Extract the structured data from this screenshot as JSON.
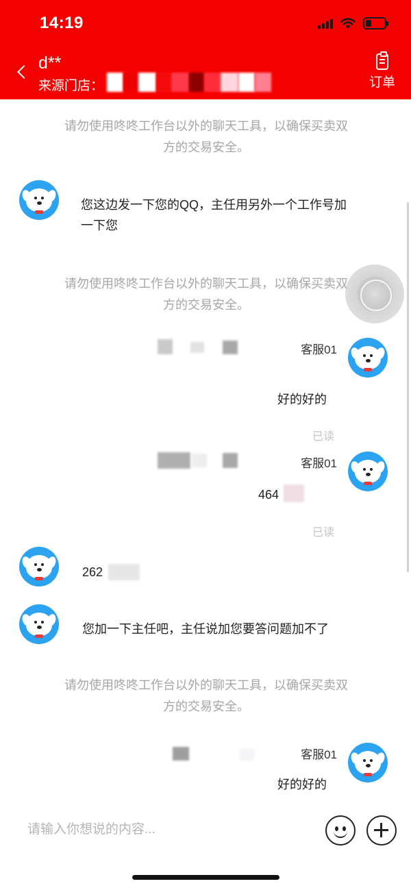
{
  "status_bar": {
    "time": "14:19"
  },
  "header": {
    "title": "d**",
    "store_label": "来源门店：",
    "order_label": "订单"
  },
  "chat": {
    "notice": "请勿使用咚咚工作台以外的聊天工具，以确保买卖双方的交易安全。",
    "messages": {
      "m1": "您这边发一下您的QQ，主任用另外一个工作号加一下您",
      "m2_agent": "客服01",
      "m2": "好的好的",
      "m2_read": "已读",
      "m3_agent": "客服01",
      "m3": "464",
      "m3_read": "已读",
      "m4": "262",
      "m5": "您加一下主任吧，主任说加您要答问题加不了",
      "m6_agent": "客服01",
      "m6": "好的好的"
    }
  },
  "input": {
    "placeholder": "请输入你想说的内容..."
  },
  "colors": {
    "brand_red": "#f40000",
    "avatar_blue": "#2ba3f0",
    "notice_gray": "#a6a6a6"
  }
}
